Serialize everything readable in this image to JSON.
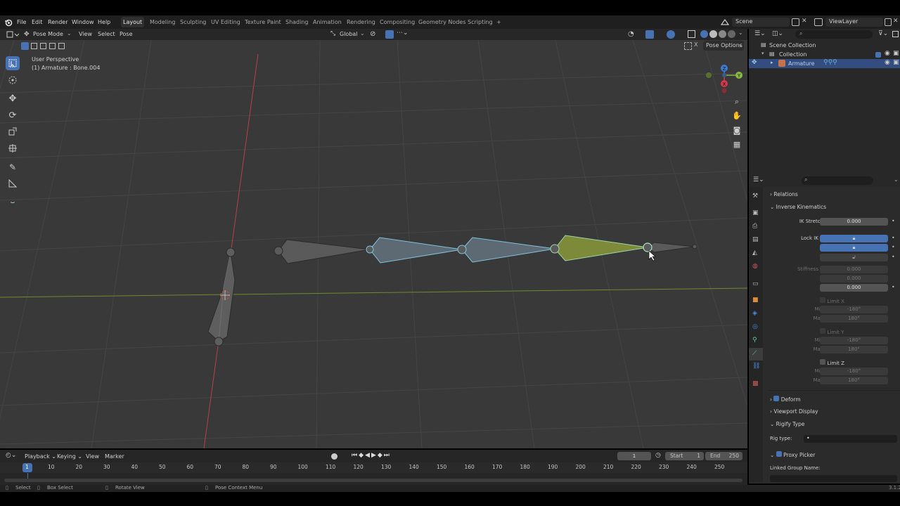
{
  "menu": [
    "File",
    "Edit",
    "Render",
    "Window",
    "Help"
  ],
  "workspaces": [
    {
      "label": "Layout",
      "active": true
    },
    {
      "label": "Modeling"
    },
    {
      "label": "Sculpting"
    },
    {
      "label": "UV Editing"
    },
    {
      "label": "Texture Paint"
    },
    {
      "label": "Shading"
    },
    {
      "label": "Animation"
    },
    {
      "label": "Rendering"
    },
    {
      "label": "Compositing"
    },
    {
      "label": "Geometry Nodes"
    },
    {
      "label": "Scripting"
    }
  ],
  "add_workspace": "+",
  "scene": "Scene",
  "view_layer": "ViewLayer",
  "viewport_header": {
    "mode": "Pose Mode",
    "menus": [
      "View",
      "Select",
      "Pose"
    ],
    "orientation": "Global",
    "pose_options": "Pose Options",
    "close": "X"
  },
  "viewport": {
    "perspective": "User Perspective",
    "object": "(1) Armature : Bone.004",
    "gizmo_axes": [
      "X",
      "Y",
      "Z"
    ]
  },
  "outliner": {
    "items": [
      {
        "label": "Scene Collection",
        "icon": "collection-icon"
      },
      {
        "label": "Collection",
        "icon": "collection-icon"
      },
      {
        "label": "Armature",
        "icon": "armature-icon",
        "selected": true
      }
    ]
  },
  "properties": {
    "relations": "Relations",
    "ik_header": "Inverse Kinematics",
    "ik_stretch_label": "IK Stretch",
    "ik_stretch_value": "0.000",
    "lock_ik_x": "Lock IK X",
    "y": "Y",
    "z": "Z",
    "stiffness_x": "Stiffness X",
    "stiffness_x_value": "0.000",
    "stiffness_y_value": "0.000",
    "stiffness_z_value": "0.000",
    "limit_x": "Limit X",
    "limit_y": "Limit Y",
    "limit_z": "Limit Z",
    "min": "Min",
    "max": "Max",
    "min_value": "-180°",
    "max_value": "180°",
    "deform": "Deform",
    "viewport_display": "Viewport Display",
    "rigify_type": "Rigify Type",
    "rig_type_label": "Rig type:",
    "rig_type_value": "",
    "proxy_picker": "Proxy Picker",
    "linked_group": "Linked Group Name:"
  },
  "timeline": {
    "menus": [
      "Playback",
      "Keying",
      "View",
      "Marker"
    ],
    "current_frame": "1",
    "start_label": "Start",
    "start_value": "1",
    "end_label": "End",
    "end_value": "250",
    "ruler": [
      "10",
      "20",
      "30",
      "40",
      "50",
      "60",
      "70",
      "80",
      "90",
      "100",
      "110",
      "120",
      "130",
      "140",
      "150",
      "160",
      "170",
      "180",
      "190",
      "200",
      "210",
      "220",
      "230",
      "240",
      "250"
    ],
    "playhead": "1"
  },
  "status": {
    "select": "Select",
    "box_select": "Box Select",
    "rotate_view": "Rotate View",
    "context_menu": "Pose Context Menu",
    "version": "3.1.2"
  },
  "colors": {
    "accent": "#4772b3",
    "x_axis": "#d23b4c",
    "y_axis": "#8ab93f",
    "z_axis": "#3d7bd6",
    "bone_selected": "#7fc3e0",
    "bone_active": "#c2e05a"
  }
}
